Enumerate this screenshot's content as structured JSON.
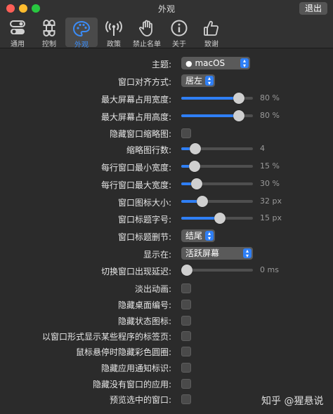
{
  "window": {
    "title": "外观",
    "quit_label": "退出"
  },
  "toolbar": [
    {
      "label": "通用",
      "icon": "toggle-icon",
      "active": false
    },
    {
      "label": "控制",
      "icon": "command-icon",
      "active": false
    },
    {
      "label": "外观",
      "icon": "palette-icon",
      "active": true
    },
    {
      "label": "政策",
      "icon": "broadcast-icon",
      "active": false
    },
    {
      "label": "禁止名单",
      "icon": "hand-icon",
      "active": false
    },
    {
      "label": "关于",
      "icon": "info-icon",
      "active": false
    },
    {
      "label": "致谢",
      "icon": "thumbs-up-icon",
      "active": false
    }
  ],
  "accent_color": "#2f7ff5",
  "settings": {
    "theme": {
      "label": "主题:",
      "value": "macOS",
      "icon": "apple-icon"
    },
    "window_align": {
      "label": "窗口对齐方式:",
      "value": "居左"
    },
    "max_screen_width": {
      "label": "最大屏幕占用宽度:",
      "value": 80,
      "text": "80 %"
    },
    "max_screen_height": {
      "label": "最大屏幕占用高度:",
      "value": 80,
      "text": "80 %"
    },
    "hide_thumbnails": {
      "label": "隐藏窗口缩略图:",
      "checked": false
    },
    "thumbnail_rows": {
      "label": "缩略图行数:",
      "value": 4,
      "fraction": 0.2,
      "text": "4"
    },
    "min_window_width": {
      "label": "每行窗口最小宽度:",
      "value": 15,
      "fraction": 0.19,
      "text": "15 %"
    },
    "max_window_width": {
      "label": "每行窗口最大宽度:",
      "value": 30,
      "fraction": 0.22,
      "text": "30 %"
    },
    "icon_size": {
      "label": "窗口图标大小:",
      "value": 32,
      "fraction": 0.29,
      "text": "32 px"
    },
    "title_font_size": {
      "label": "窗口标题字号:",
      "value": 15,
      "fraction": 0.54,
      "text": "15 px"
    },
    "title_truncation": {
      "label": "窗口标题删节:",
      "value": "结尾"
    },
    "show_on": {
      "label": "显示在:",
      "value": "活跃屏幕"
    },
    "appear_delay": {
      "label": "切换窗口出现延迟:",
      "value": 0,
      "fraction": 0.0,
      "text": "0 ms"
    },
    "fade_out": {
      "label": "淡出动画:",
      "checked": false
    },
    "hide_space_number": {
      "label": "隐藏桌面编号:",
      "checked": false
    },
    "hide_status_icons": {
      "label": "隐藏状态图标:",
      "checked": false
    },
    "tabs_as_windows": {
      "label": "以窗口形式显示某些程序的标签页:",
      "checked": false
    },
    "hide_hover_color": {
      "label": "鼠标悬停时隐藏彩色圆圈:",
      "checked": false
    },
    "hide_app_badges": {
      "label": "隐藏应用通知标识:",
      "checked": false
    },
    "hide_windowless_apps": {
      "label": "隐藏没有窗口的应用:",
      "checked": false
    },
    "preview_selected": {
      "label": "预览选中的窗口:",
      "checked": false
    }
  },
  "watermark": "知乎 @猩悬说"
}
